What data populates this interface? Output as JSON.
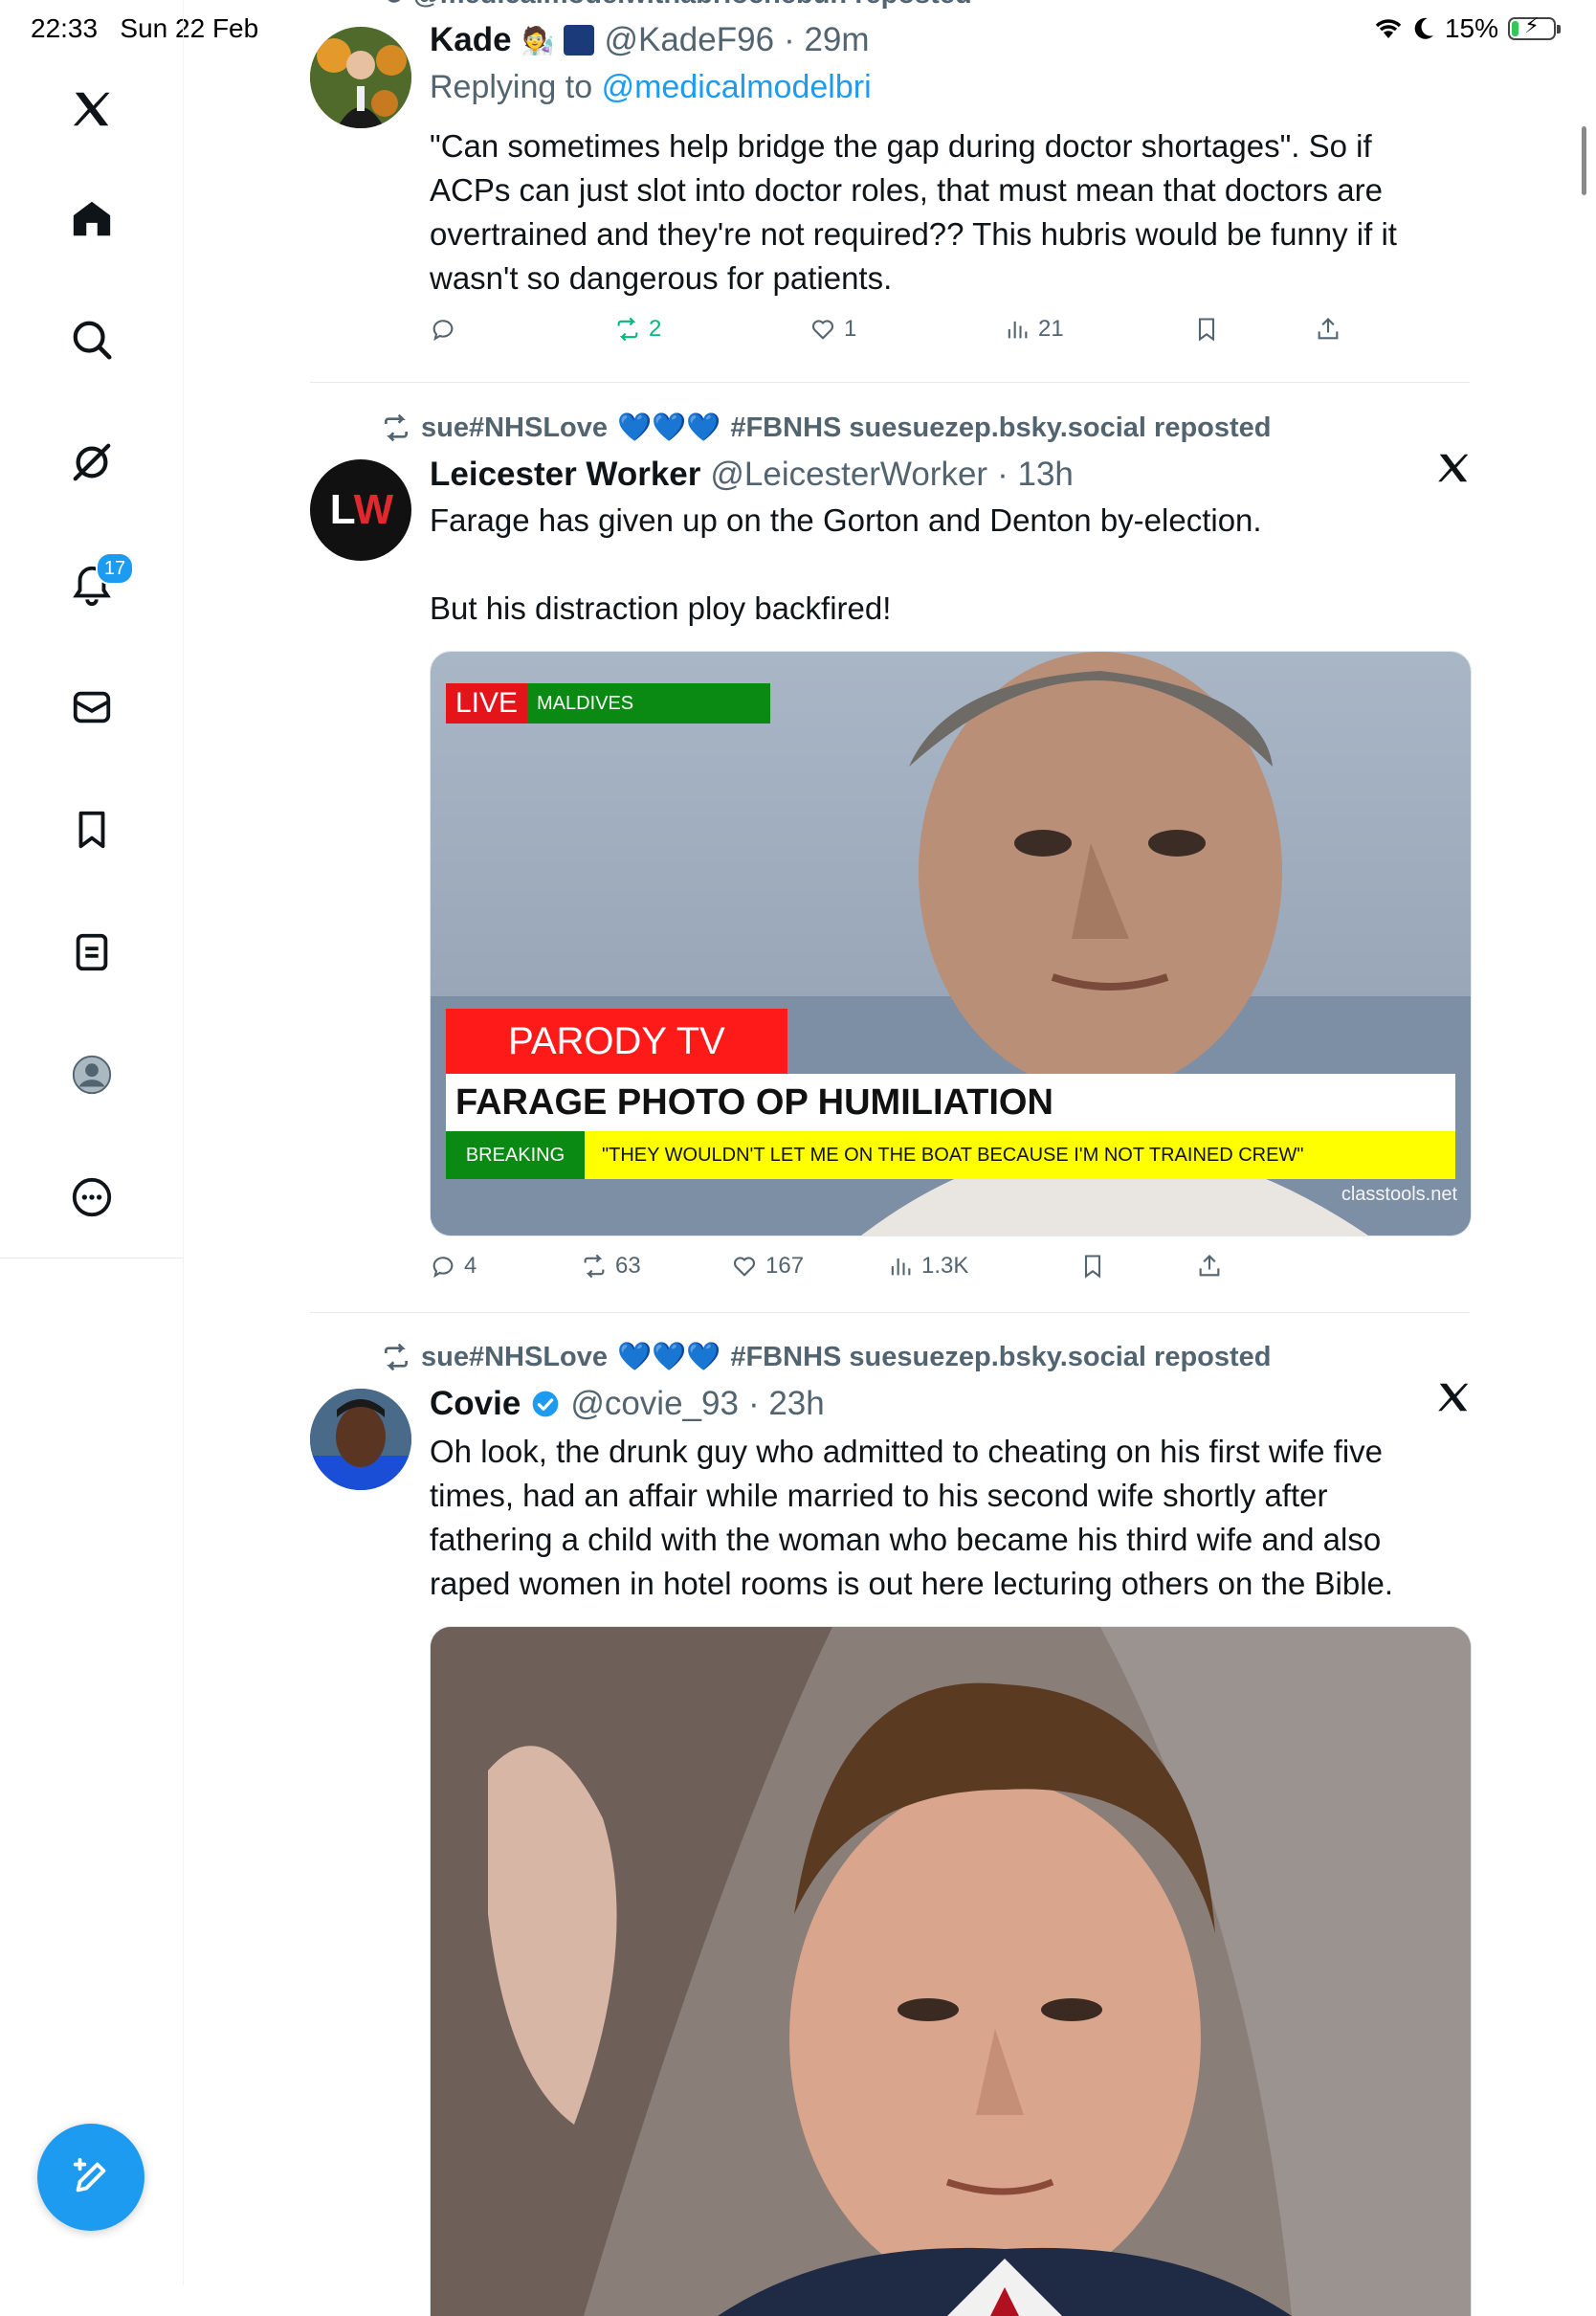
{
  "status_bar": {
    "time": "22:33",
    "date": "Sun 22 Feb",
    "battery": "15%"
  },
  "sidebar": {
    "notification_count": "17",
    "items": [
      "x-logo",
      "home",
      "search",
      "grok",
      "notifications",
      "messages",
      "bookmarks",
      "lists",
      "profile",
      "more"
    ]
  },
  "top_cut_text": "@medicalmodelwithabriochebun reposted",
  "tweets": [
    {
      "name": "Kade",
      "handle": "@KadeF96",
      "time": "· 29m",
      "reply_label": "Replying to",
      "reply_mention": "@medicalmodelbri",
      "text": "\"Can sometimes help bridge the gap during doctor shortages\". So if ACPs can just slot into doctor roles, that must mean that doctors are overtrained and they're not required?? This hubris would be funny if it wasn't so dangerous for patients.",
      "replies": "",
      "reposts": "2",
      "likes": "1",
      "views": "21"
    },
    {
      "repost_by": "sue#NHSLove",
      "repost_suffix": "#FBNHS suesuezep.bsky.social reposted",
      "avatar_text": "LW",
      "name": "Leicester Worker",
      "handle": "@LeicesterWorker",
      "time": "· 13h",
      "text": "Farage has given up on the Gorton and Denton by-election.\n\nBut his distraction ploy backfired!",
      "media": {
        "live": "LIVE",
        "location": "MALDIVES",
        "channel": "PARODY TV",
        "headline": "FARAGE PHOTO OP HUMILIATION",
        "breaking": "BREAKING",
        "ticker": "\"THEY WOULDN'T LET ME ON THE BOAT BECAUSE I'M NOT TRAINED CREW\"",
        "watermark": "classtools.net"
      },
      "replies": "4",
      "reposts": "63",
      "likes": "167",
      "views": "1.3K"
    },
    {
      "repost_by": "sue#NHSLove",
      "repost_suffix": "#FBNHS suesuezep.bsky.social reposted",
      "name": "Covie",
      "handle": "@covie_93",
      "time": "· 23h",
      "text": "Oh look, the drunk guy who admitted to cheating on his first wife five times, had an affair while married to his second wife shortly after fathering a child with the woman who became his third wife and also raped women in hotel rooms is out here lecturing others on the Bible."
    }
  ],
  "colors": {
    "accent": "#1d9bf0",
    "repost_green": "#00ba7c",
    "secondary_text": "#536471"
  }
}
